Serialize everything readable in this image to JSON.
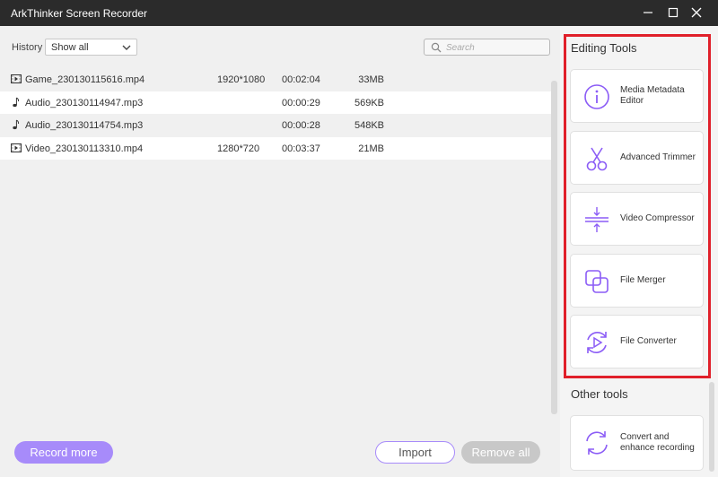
{
  "window": {
    "title": "ArkThinker Screen Recorder"
  },
  "history": {
    "label": "History",
    "selected": "Show all"
  },
  "search": {
    "placeholder": "Search"
  },
  "files": [
    {
      "type": "video",
      "name": "Game_230130115616.mp4",
      "resolution": "1920*1080",
      "duration": "00:02:04",
      "size": "33MB"
    },
    {
      "type": "audio",
      "name": "Audio_230130114947.mp3",
      "resolution": "",
      "duration": "00:00:29",
      "size": "569KB"
    },
    {
      "type": "audio",
      "name": "Audio_230130114754.mp3",
      "resolution": "",
      "duration": "00:00:28",
      "size": "548KB"
    },
    {
      "type": "video",
      "name": "Video_230130113310.mp4",
      "resolution": "1280*720",
      "duration": "00:03:37",
      "size": "21MB"
    }
  ],
  "buttons": {
    "record_more": "Record more",
    "import": "Import",
    "remove_all": "Remove all"
  },
  "editing_tools": {
    "title": "Editing Tools",
    "items": [
      {
        "label": "Media Metadata Editor",
        "icon": "info-icon"
      },
      {
        "label": "Advanced Trimmer",
        "icon": "scissors-icon"
      },
      {
        "label": "Video Compressor",
        "icon": "compress-icon"
      },
      {
        "label": "File Merger",
        "icon": "merge-icon"
      },
      {
        "label": "File Converter",
        "icon": "convert-icon"
      }
    ]
  },
  "other_tools": {
    "title": "Other tools",
    "items": [
      {
        "label": "Convert and enhance recording",
        "icon": "refresh-icon"
      }
    ]
  },
  "colors": {
    "accent": "#a78bfa",
    "highlight": "#e0202a",
    "titlebar": "#2b2b2b"
  }
}
